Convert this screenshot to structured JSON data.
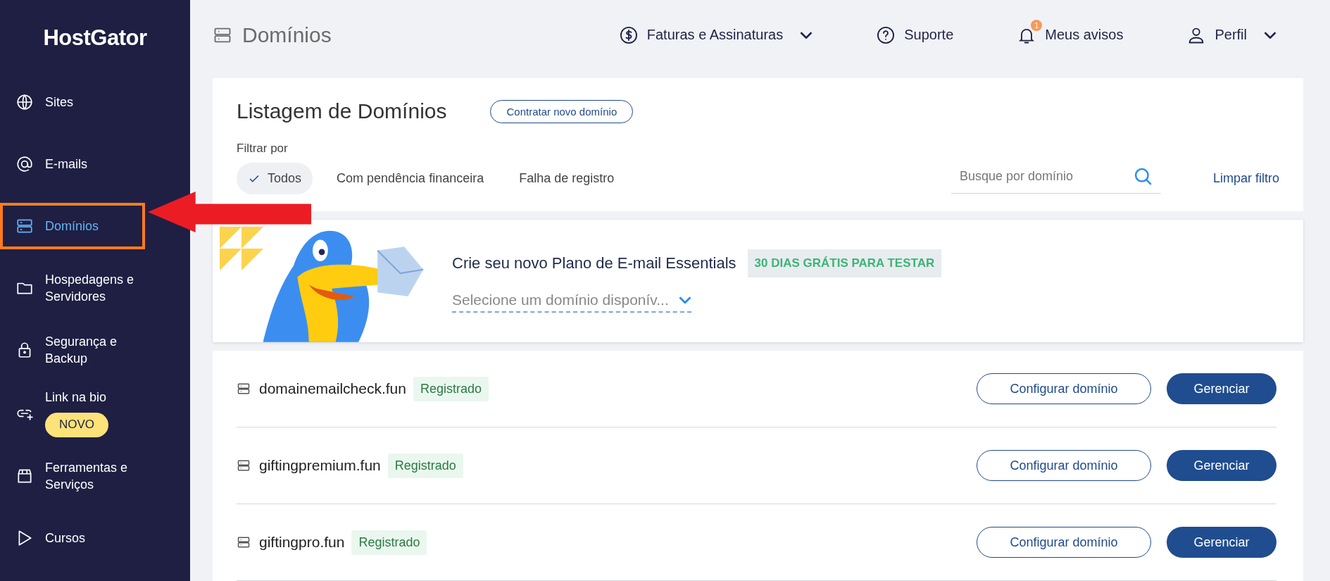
{
  "sidebar": {
    "logo": "HostGator",
    "items": [
      {
        "label": "Sites",
        "selected": false
      },
      {
        "label": "E-mails",
        "selected": false
      },
      {
        "label": "Domínios",
        "selected": true
      },
      {
        "label": "Hospedagens e Servidores",
        "selected": false
      },
      {
        "label": "Segurança e Backup",
        "selected": false
      },
      {
        "label": "Link na bio",
        "selected": false,
        "badge": "NOVO"
      },
      {
        "label": "Ferramentas e Serviços",
        "selected": false
      },
      {
        "label": "Cursos",
        "selected": false
      }
    ]
  },
  "header": {
    "title": "Domínios",
    "nav": [
      {
        "label": "Faturas e Assinaturas",
        "dropdown": true
      },
      {
        "label": "Suporte",
        "dropdown": false
      },
      {
        "label": "Meus avisos",
        "dropdown": false,
        "count": "1"
      },
      {
        "label": "Perfil",
        "dropdown": true
      }
    ]
  },
  "listing": {
    "title": "Listagem de Domínios",
    "new_button": "Contratar novo domínio",
    "filter_label": "Filtrar por",
    "filters": [
      {
        "label": "Todos",
        "selected": true
      },
      {
        "label": "Com pendência financeira",
        "selected": false
      },
      {
        "label": "Falha de registro",
        "selected": false
      }
    ],
    "search": {
      "placeholder": "Busque por domínio"
    },
    "clear": "Limpar filtro"
  },
  "promo": {
    "text": "Crie seu novo Plano de E-mail Essentials",
    "tag": "30 DIAS GRÁTIS PARA TESTAR",
    "select_placeholder": "Selecione um domínio disponív..."
  },
  "domains": [
    {
      "name": "domainemailcheck.fun",
      "status": "Registrado",
      "configure": "Configurar domínio",
      "manage": "Gerenciar"
    },
    {
      "name": "giftingpremium.fun",
      "status": "Registrado",
      "configure": "Configurar domínio",
      "manage": "Gerenciar"
    },
    {
      "name": "giftingpro.fun",
      "status": "Registrado",
      "configure": "Configurar domínio",
      "manage": "Gerenciar"
    }
  ]
}
